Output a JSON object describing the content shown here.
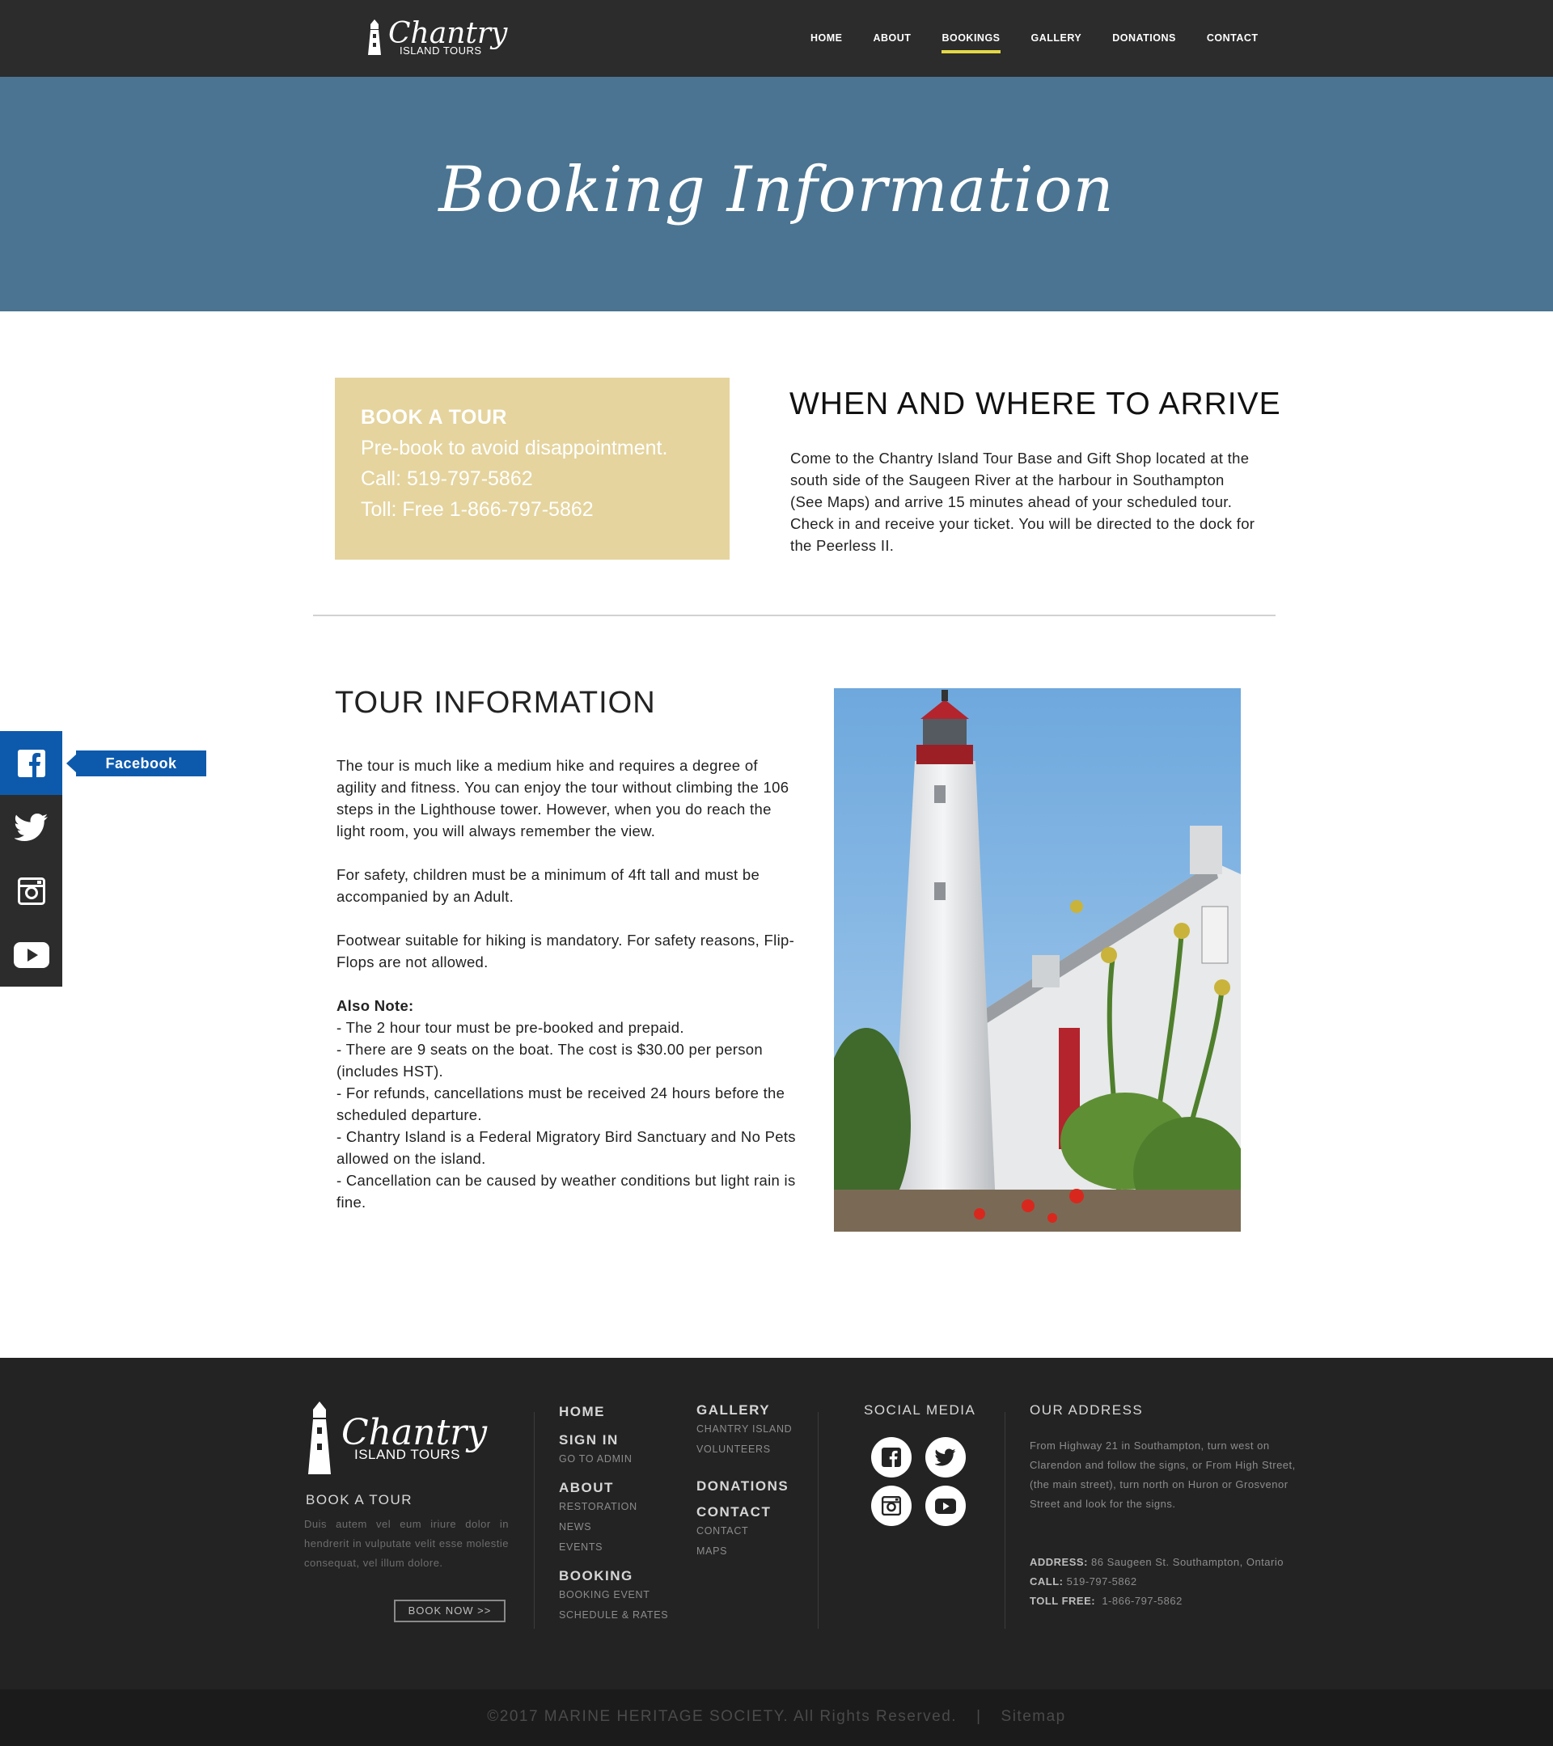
{
  "brand": {
    "script": "Chantry",
    "sub": "ISLAND TOURS"
  },
  "nav": {
    "items": [
      {
        "label": "HOME"
      },
      {
        "label": "ABOUT"
      },
      {
        "label": "BOOKINGS"
      },
      {
        "label": "GALLERY"
      },
      {
        "label": "DONATIONS"
      },
      {
        "label": "CONTACT"
      }
    ],
    "active": "BOOKINGS",
    "active_indicator_color": "#e3d846"
  },
  "hero": {
    "title": "Booking Information",
    "bg_color": "#4a7491"
  },
  "book_box": {
    "title": "BOOK A TOUR",
    "line1": "Pre-book to avoid disappointment.",
    "line2": "Call: 519-797-5862",
    "line3": "Toll: Free 1-866-797-5862",
    "bg_color": "#e5d49e"
  },
  "arrive": {
    "title": "WHEN AND WHERE TO ARRIVE",
    "text": "Come to the Chantry Island Tour Base and Gift Shop located at the south side of the Saugeen River at the harbour in Southampton (See Maps) and arrive 15 minutes ahead of your scheduled tour. Check in and receive your ticket. You will be directed to the dock for the Peerless II."
  },
  "tour": {
    "title": "TOUR INFORMATION",
    "p1": "The tour is much like a medium hike and requires a degree of agility and fitness. You can enjoy the tour without climbing the 106 steps in the Lighthouse tower. However, when you do reach the light room, you will always remember the view.",
    "p2": "For safety, children must be a minimum of 4ft tall and must be accompanied by an Adult.",
    "p3": "Footwear suitable for hiking is mandatory. For safety reasons, Flip-Flops are not allowed.",
    "note_heading": "Also Note:",
    "notes": [
      "- The 2 hour tour must be pre-booked and prepaid.",
      "- There are 9 seats on the boat. The cost is $30.00 per person (includes HST).",
      "- For refunds, cancellations must be received 24 hours before the scheduled departure.",
      "- Chantry Island is a Federal Migratory Bird Sanctuary and No Pets allowed on the island.",
      "- Cancellation can be caused by weather conditions but light rain is fine."
    ]
  },
  "sidebar": {
    "items": [
      {
        "icon": "facebook-icon"
      },
      {
        "icon": "twitter-icon"
      },
      {
        "icon": "instagram-icon"
      },
      {
        "icon": "youtube-icon"
      }
    ],
    "tooltip": "Facebook",
    "facebook_color": "#0d5aad"
  },
  "footer": {
    "book_title": "BOOK A TOUR",
    "book_text": "Duis autem vel eum iriure dolor in hendrerit in vulputate velit esse molestie consequat, vel illum dolore.",
    "book_button": "BOOK NOW >>",
    "col1": {
      "home": "HOME",
      "signin": "SIGN IN",
      "goto_admin": "GO TO ADMIN",
      "about": "ABOUT",
      "restoration": "RESTORATION",
      "news": "NEWS",
      "events": "EVENTS",
      "booking": "BOOKING",
      "booking_event": "BOOKING EVENT",
      "schedule": "SCHEDULE & RATES"
    },
    "col2": {
      "gallery": "GALLERY",
      "chantry_island": "CHANTRY ISLAND",
      "volunteers": "VOLUNTEERS",
      "donations": "DONATIONS",
      "contact": "CONTACT",
      "contact_sub": "CONTACT",
      "maps": "MAPS"
    },
    "social_title": "SOCIAL MEDIA",
    "address_title": "OUR ADDRESS",
    "address_text": "From Highway 21 in Southampton, turn west on Clarendon and follow the signs, or From High Street, (the main street), turn north on Huron or Grosvenor Street and look for the signs.",
    "address_label": "ADDRESS:",
    "address_value": "86 Saugeen St. Southampton, Ontario",
    "call_label": "CALL:",
    "call_value": "519-797-5862",
    "toll_label": "TOLL FREE:",
    "toll_value": "1-866-797-5862",
    "copyright": "©2017 MARINE HERITAGE SOCIETY. All Rights Reserved.",
    "separator": "|",
    "sitemap": "Sitemap"
  }
}
